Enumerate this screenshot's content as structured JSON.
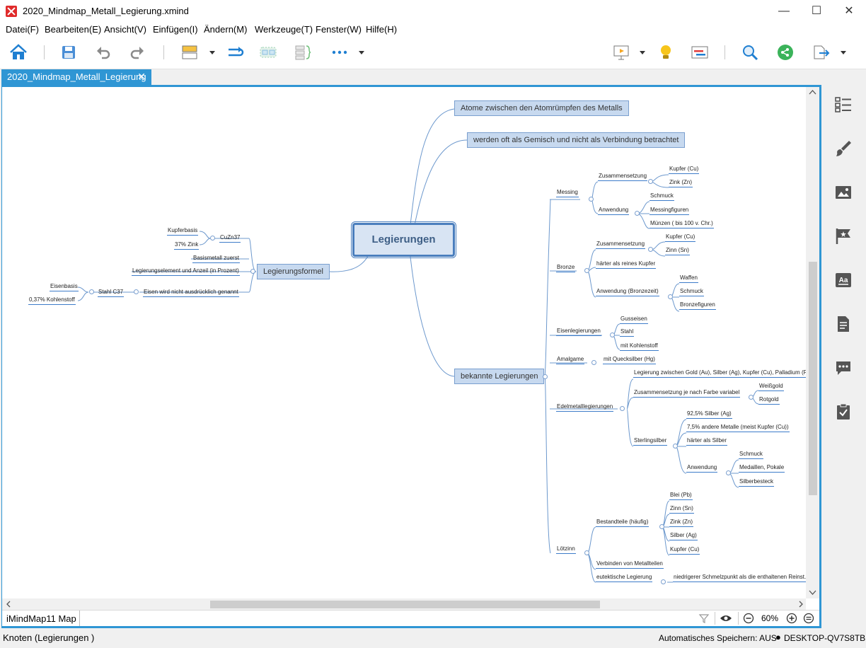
{
  "window": {
    "title": "2020_Mindmap_Metall_Legierung.xmind",
    "minimize": "—",
    "maximize": "☐",
    "close": "✕"
  },
  "menu": [
    "Datei(F)",
    "Bearbeiten(E)",
    "Ansicht(V)",
    "Einfügen(I)",
    "Ändern(M)",
    "Werkzeuge(T)",
    "Fenster(W)",
    "Hilfe(H)"
  ],
  "tab": {
    "label": "2020_Mindmap_Metall_Legierung",
    "close": "✕"
  },
  "colors": {
    "accent": "#2f96d4",
    "node_border": "#3d7cc9",
    "topic_fill": "#c7d9ef"
  },
  "toolbar": {
    "icons": [
      "home-icon",
      "save-icon",
      "undo-icon",
      "redo-icon",
      "structure-icon",
      "relationship-icon",
      "boundary-icon",
      "summary-icon",
      "more-icon",
      "presentation-icon",
      "idea-icon",
      "gantt-icon",
      "search-icon",
      "share-icon",
      "export-icon"
    ]
  },
  "map": {
    "central": "Legierungen",
    "mains": {
      "atome": "Atome zwischen den Atomrümpfen des Metalls",
      "gemisch": "werden oft als Gemisch und nicht als Verbindung betrachtet",
      "formel": "Legierungsformel",
      "bekannt": "bekannte Legierungen"
    },
    "left": {
      "cuzn37": "CuZn37",
      "kupferbasis": "Kupferbasis",
      "zink37": "37% Zink",
      "basismetall": "Basismetall zuerst",
      "element": "Legierungselement und Anzeil (in Prozent)",
      "eisen": "Eisen wird nicht ausdrücklich genannt",
      "stahl": "Stahl C37",
      "eisenbasis": "Eisenbasis",
      "kohlenstoff": "0,37% Kohlenstoff"
    },
    "right": {
      "messing": "Messing",
      "zus1": "Zusammensetzung",
      "kupfer1": "Kupfer (Cu)",
      "zink1": "Zink (Zn)",
      "anw1": "Anwendung",
      "schmuck1": "Schmuck",
      "messingfig": "Messingfiguren",
      "muenzen": "Münzen ( bis 100 v. Chr.)",
      "bronze": "Bronze",
      "zus2": "Zusammensetzung",
      "kupfer2": "Kupfer (Cu)",
      "zinn2": "Zinn (Sn)",
      "haerter": "härter als reines Kupfer",
      "anw2": "Anwendung (Bronzezeit)",
      "waffen": "Waffen",
      "schmuck2": "Schmuck",
      "bronzefig": "Bronzefiguren",
      "eisenleg": "Eisenlegierungen",
      "gusseisen": "Gusseisen",
      "stahl2": "Stahl",
      "mitkohle": "mit Kohlenstoff",
      "amalgame": "Amalgame",
      "quecksilber": "mit Quecksilber (Hg)",
      "edel": "Edelmetalllegierungen",
      "leggold": "Legierung zwischen Gold (Au), Silber (Ag), Kupfer (Cu), Palladium (Pd)...",
      "zusfarbe": "Zusammensetzung je nach Farbe variabel",
      "weissgold": "Weißgold",
      "rotgold": "Rotgold",
      "sterling": "Sterlingsilber",
      "silber925": "92,5% Silber (Ag)",
      "andere75": "7,5% andere Metalle (meist Kupfer (Cu))",
      "haerterals": "härter als Silber",
      "anw3": "Anwendung",
      "schmuck3": "Schmuck",
      "medaillen": "Medaillen, Pokale",
      "besteck": "Silberbesteck",
      "loetzinn": "Lötzinn",
      "bestandteile": "Bestandteile (häufig)",
      "blei": "Blei (Pb)",
      "zinn3": "Zinn (Sn)",
      "zink3": "Zink (Zn)",
      "silber3": "Silber (Ag)",
      "kupfer3": "Kupfer (Cu)",
      "verbinden": "Verbinden von Metallteilen",
      "eutektisch": "eutektische Legierung",
      "niedriger": "niedrigerer Schmelzpunkt als die enthaltenen Reinst..."
    }
  },
  "bottom": {
    "sheet": "iMindMap11 Map",
    "zoom": "60%"
  },
  "status": {
    "left": "Knoten (Legierungen )",
    "autosave": "Automatisches Speichern: AUS",
    "machine": "DESKTOP-QV7S8TB"
  }
}
